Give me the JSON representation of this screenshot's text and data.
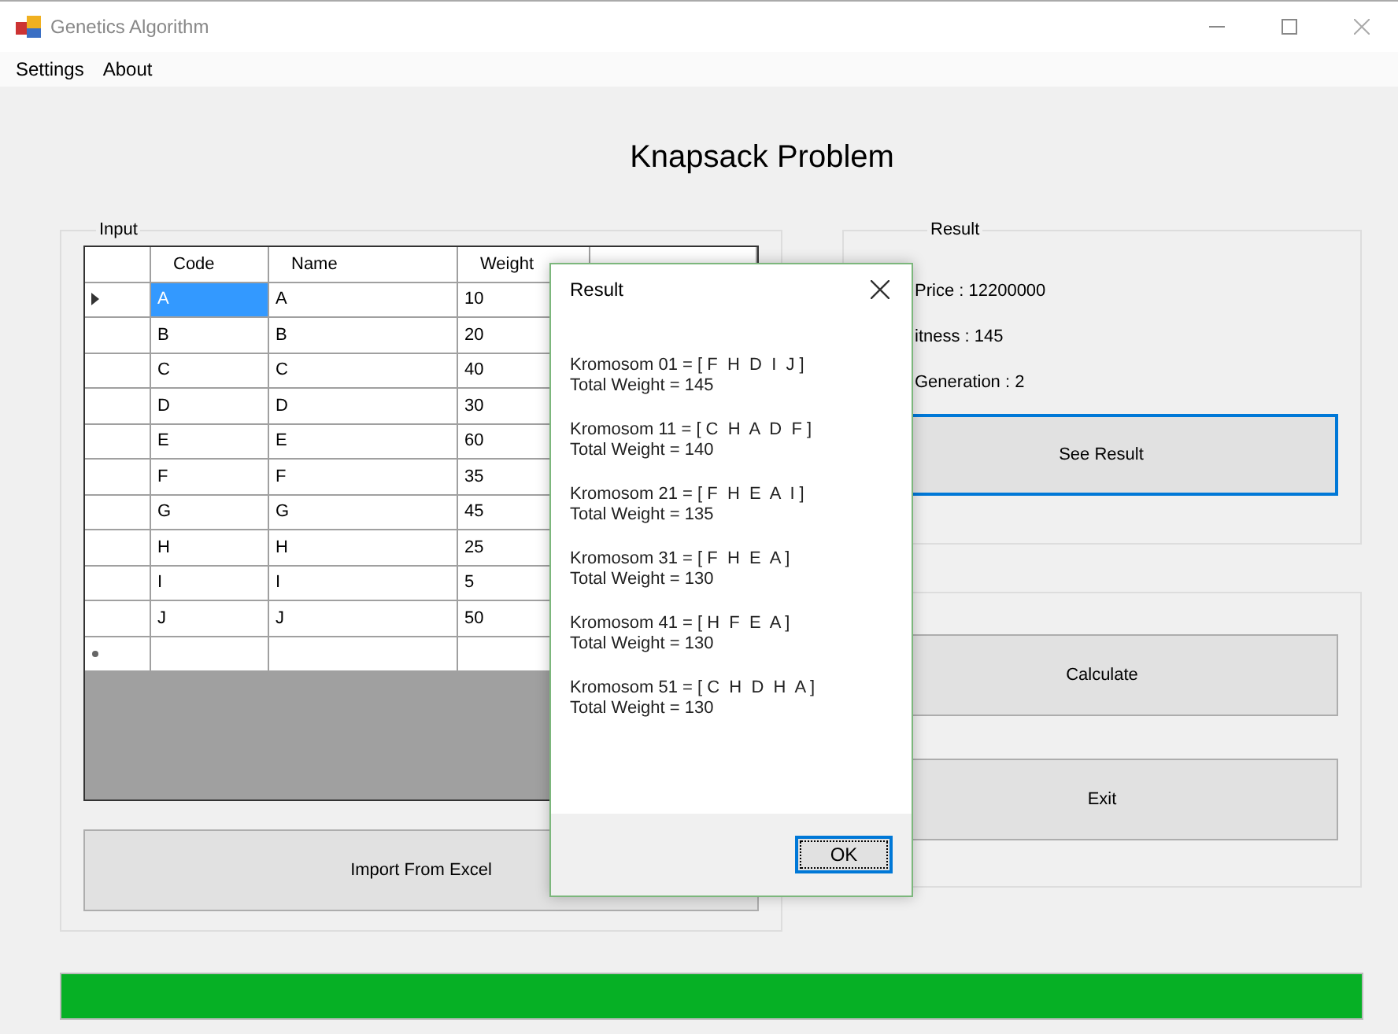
{
  "window": {
    "title": "Genetics Algorithm"
  },
  "menu": [
    {
      "label": "Settings"
    },
    {
      "label": "About"
    }
  ],
  "heading": "Knapsack Problem",
  "input_group": {
    "label": "Input",
    "table": {
      "columns": [
        "Code",
        "Name",
        "Weight"
      ],
      "rows": [
        {
          "cells": [
            "A",
            "A",
            "10"
          ],
          "selected": true
        },
        {
          "cells": [
            "B",
            "B",
            "20"
          ],
          "selected": false
        },
        {
          "cells": [
            "C",
            "C",
            "40"
          ],
          "selected": false
        },
        {
          "cells": [
            "D",
            "D",
            "30"
          ],
          "selected": false
        },
        {
          "cells": [
            "E",
            "E",
            "60"
          ],
          "selected": false
        },
        {
          "cells": [
            "F",
            "F",
            "35"
          ],
          "selected": false
        },
        {
          "cells": [
            "G",
            "G",
            "45"
          ],
          "selected": false
        },
        {
          "cells": [
            "H",
            "H",
            "25"
          ],
          "selected": false
        },
        {
          "cells": [
            "I",
            "I",
            "5"
          ],
          "selected": false
        },
        {
          "cells": [
            "J",
            "J",
            "50"
          ],
          "selected": false
        }
      ]
    },
    "button": "Import From Excel"
  },
  "result_group": {
    "label": "Result",
    "lines": [
      "Price : 12200000",
      "itness : 145",
      "Generation : 2"
    ],
    "button": {
      "label": "See Result",
      "focused": true
    }
  },
  "action_buttons": [
    "Calculate",
    "Exit"
  ],
  "progress": {
    "level": 1
  },
  "dialog": {
    "title": "Result",
    "entries": [
      {
        "chromosome": "Kromosom 01 = [ F  H  D  I  J ]",
        "weight": "Total Weight = 145"
      },
      {
        "chromosome": "Kromosom 11 = [ C  H  A  D  F ]",
        "weight": "Total Weight = 140"
      },
      {
        "chromosome": "Kromosom 21 = [ F  H  E  A  I ]",
        "weight": "Total Weight = 135"
      },
      {
        "chromosome": "Kromosom 31 = [ F  H  E  A ]",
        "weight": "Total Weight = 130"
      },
      {
        "chromosome": "Kromosom 41 = [ H  F  E  A ]",
        "weight": "Total Weight = 130"
      },
      {
        "chromosome": "Kromosom 51 = [ C  H  D  H  A ]",
        "weight": "Total Weight = 130"
      }
    ],
    "button": "OK"
  }
}
